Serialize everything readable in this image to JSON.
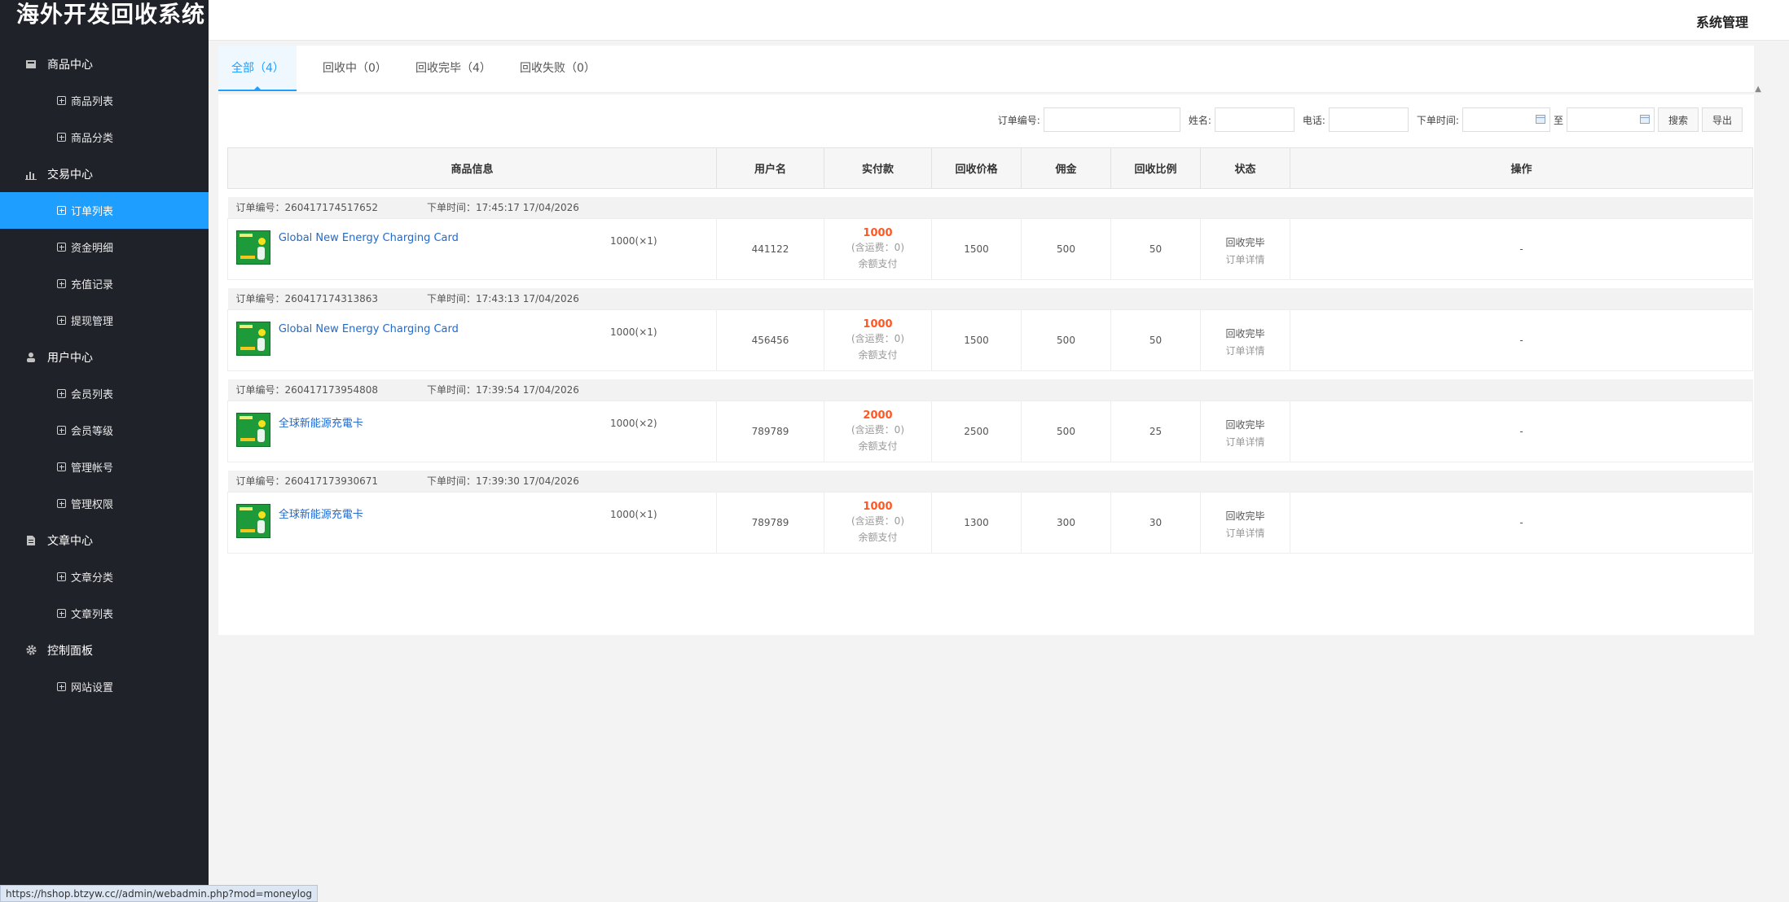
{
  "app": {
    "title": "海外开发回收系统",
    "header_right": "系统管理"
  },
  "sidebar": {
    "groups": [
      {
        "label": "商品中心",
        "icon": "inbox-icon",
        "items": [
          "商品列表",
          "商品分类"
        ]
      },
      {
        "label": "交易中心",
        "icon": "bar-chart-icon",
        "items": [
          "订单列表",
          "资金明细",
          "充值记录",
          "提现管理"
        ]
      },
      {
        "label": "用户中心",
        "icon": "user-icon",
        "items": [
          "会员列表",
          "会员等级",
          "管理帐号",
          "管理权限"
        ]
      },
      {
        "label": "文章中心",
        "icon": "document-icon",
        "items": [
          "文章分类",
          "文章列表"
        ]
      },
      {
        "label": "控制面板",
        "icon": "gear-icon",
        "items": [
          "网站设置"
        ]
      }
    ],
    "active_item": "订单列表"
  },
  "tabs": [
    "全部（4）",
    "回收中（0）",
    "回收完毕（4）",
    "回收失败（0）"
  ],
  "search": {
    "order_no_label": "订单编号:",
    "name_label": "姓名:",
    "phone_label": "电话:",
    "time_label": "下单时间:",
    "to_label": "至",
    "search_button": "搜索",
    "export_button": "导出"
  },
  "table": {
    "headers": [
      "商品信息",
      "用户名",
      "实付款",
      "回收价格",
      "佣金",
      "回收比例",
      "状态",
      "操作"
    ],
    "orders": [
      {
        "order_no_label": "订单编号：260417174517652",
        "time_label": "下单时间：17:45:17 17/04/2026",
        "goods": "Global New Energy Charging Card",
        "qty": "1000(×1)",
        "user": "441122",
        "paid": "1000",
        "shipping": "(含运费：0)",
        "pay_method": "余额支付",
        "recycle_price": "1500",
        "commission": "500",
        "ratio": "50",
        "status": "回收完毕",
        "detail": "订单详情",
        "action": "-"
      },
      {
        "order_no_label": "订单编号：260417174313863",
        "time_label": "下单时间：17:43:13 17/04/2026",
        "goods": "Global New Energy Charging Card",
        "qty": "1000(×1)",
        "user": "456456",
        "paid": "1000",
        "shipping": "(含运费：0)",
        "pay_method": "余额支付",
        "recycle_price": "1500",
        "commission": "500",
        "ratio": "50",
        "status": "回收完毕",
        "detail": "订单详情",
        "action": "-"
      },
      {
        "order_no_label": "订单编号：260417173954808",
        "time_label": "下单时间：17:39:54 17/04/2026",
        "goods": "全球新能源充電卡",
        "qty": "1000(×2)",
        "user": "789789",
        "paid": "2000",
        "shipping": "(含运费：0)",
        "pay_method": "余额支付",
        "recycle_price": "2500",
        "commission": "500",
        "ratio": "25",
        "status": "回收完毕",
        "detail": "订单详情",
        "action": "-"
      },
      {
        "order_no_label": "订单编号：260417173930671",
        "time_label": "下单时间：17:39:30 17/04/2026",
        "goods": "全球新能源充電卡",
        "qty": "1000(×1)",
        "user": "789789",
        "paid": "1000",
        "shipping": "(含运费：0)",
        "pay_method": "余额支付",
        "recycle_price": "1300",
        "commission": "300",
        "ratio": "30",
        "status": "回收完毕",
        "detail": "订单详情",
        "action": "-"
      }
    ]
  },
  "status_bar": "https://hshop.btzyw.cc//admin/webadmin.php?mod=moneylog",
  "colors": {
    "sidebar_bg": "#20222a",
    "accent": "#1e9fff",
    "price": "#ff5722",
    "link": "#1e6ad0"
  }
}
